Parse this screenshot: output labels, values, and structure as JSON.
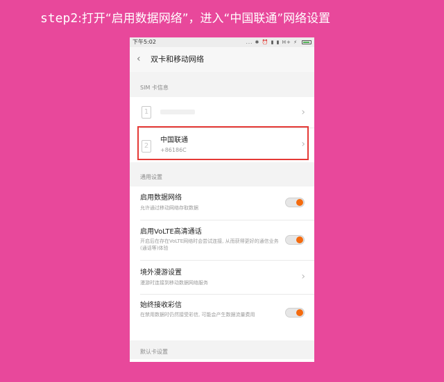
{
  "caption": {
    "step": "step2",
    "text": ":打开“启用数据网络”，进入“中国联通”网络设置"
  },
  "statusbar": {
    "time": "下午5:02",
    "icons": "... ✱ ⏰ ▮ ▮ H+ ⚡",
    "battery_color": "#4caf50"
  },
  "nav": {
    "back_icon": "‹",
    "title": "双卡和移动网络"
  },
  "sim_section": {
    "label": "SIM 卡信息",
    "sim1": {
      "slot": "1"
    },
    "sim2": {
      "slot": "2",
      "name": "中国联通",
      "number": "+86186C"
    }
  },
  "general_section": {
    "label": "通用设置",
    "items": [
      {
        "title": "启用数据网络",
        "sub": "允许通过移动网络存取数据",
        "toggle": "on"
      },
      {
        "title": "启用VoLTE高清通话",
        "sub": "开启后在存在VoLTE网络时会尝试连接, 从而获得更好的通信业务(通话等)体验",
        "toggle": "on"
      },
      {
        "title": "境外漫游设置",
        "sub": "漫游时连接到移动数据网络服务"
      },
      {
        "title": "始终接收彩信",
        "sub": "在禁用数据时仍然接受彩信, 可能会产生数据流量费用",
        "toggle": "on"
      }
    ]
  },
  "default_section": {
    "label": "默认卡设置"
  },
  "chevron": "›",
  "colors": {
    "background": "#e8489b",
    "toggle_knob": "#f46b0f",
    "highlight": "#e53935"
  }
}
